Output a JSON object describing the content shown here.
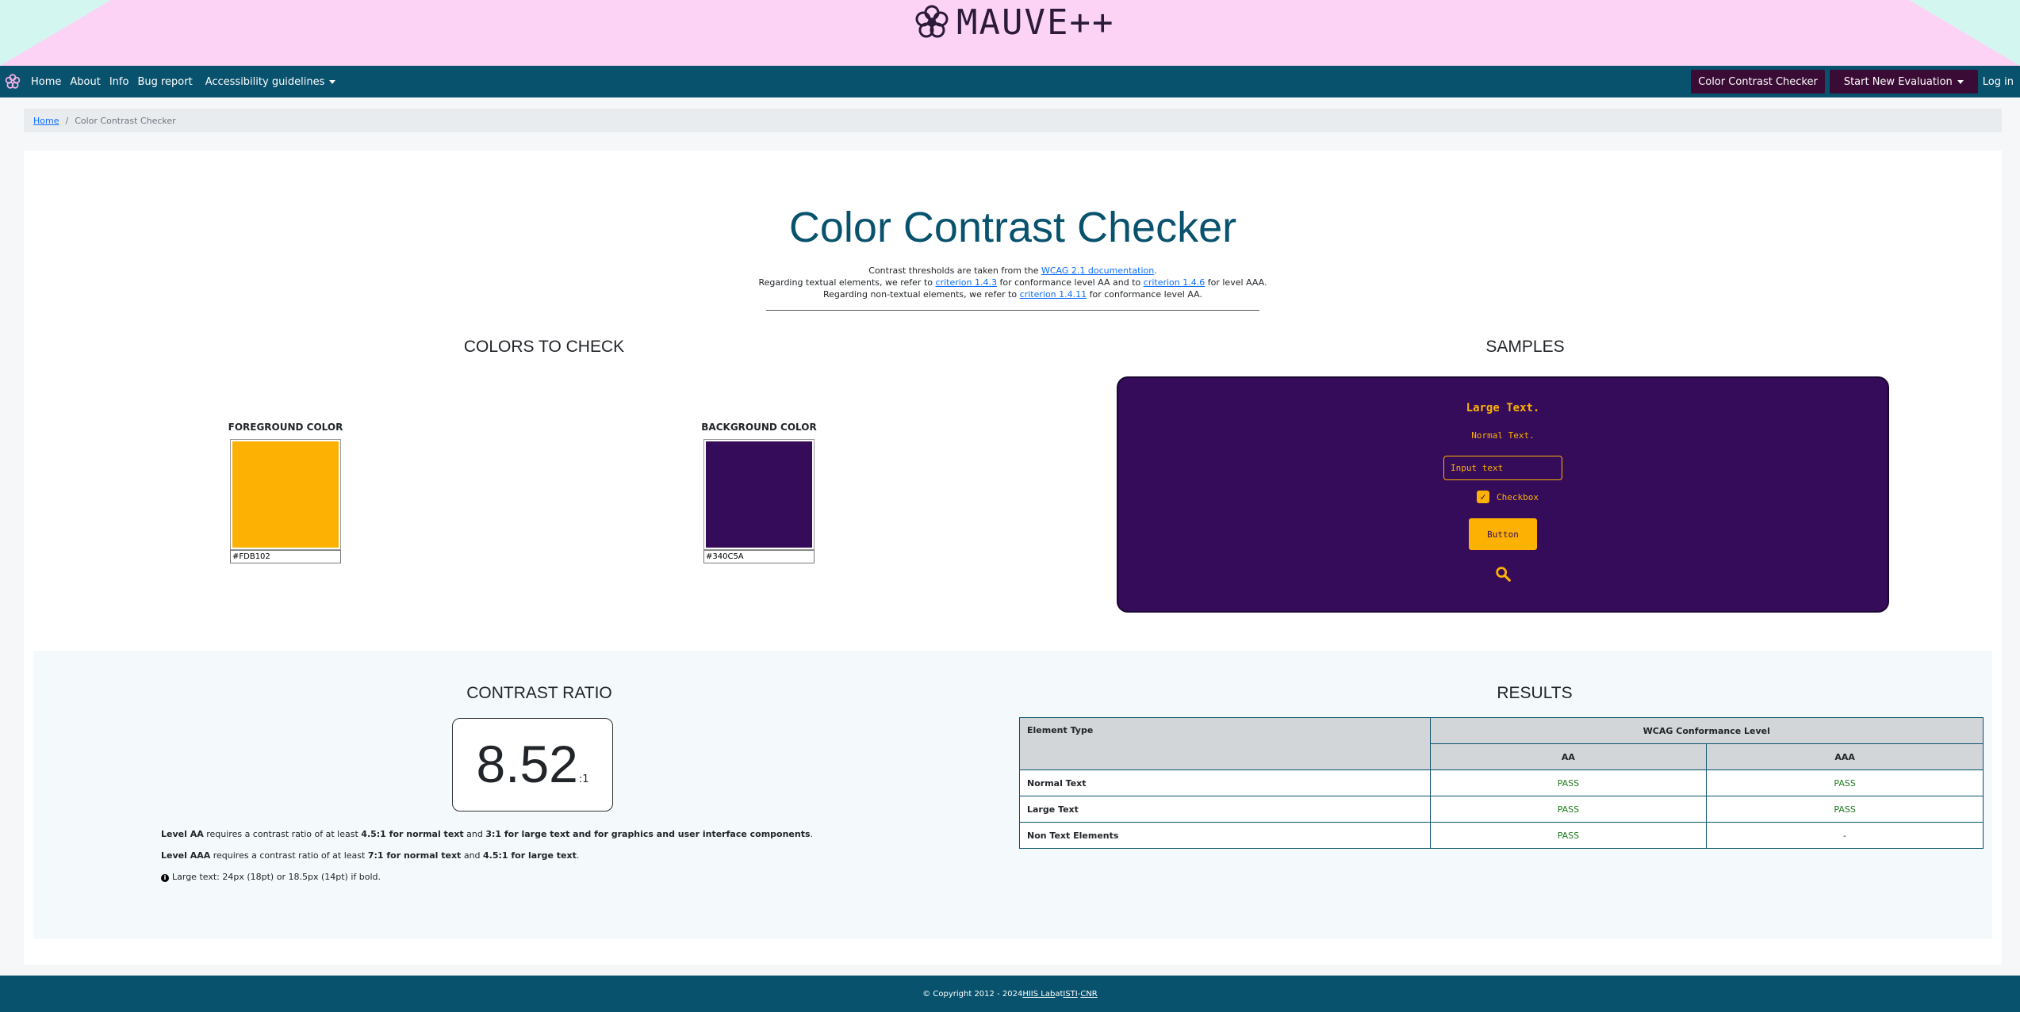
{
  "brand": {
    "name": "MAUVE++"
  },
  "nav": {
    "links": [
      "Home",
      "About",
      "Info",
      "Bug report",
      "Accessibility guidelines"
    ],
    "color_contrast_button": "Color Contrast Checker",
    "start_eval_button": "Start New Evaluation",
    "login": "Log in"
  },
  "breadcrumb": {
    "home": "Home",
    "separator": "/",
    "current": "Color Contrast Checker"
  },
  "page": {
    "title": "Color Contrast Checker",
    "intro": {
      "line1_pre": "Contrast thresholds are taken from the ",
      "line1_link": "WCAG 2.1 documentation",
      "line1_post": ".",
      "line2_pre": "Regarding textual elements, we refer to ",
      "line2_link1": "criterion 1.4.3",
      "line2_mid": " for conformance level AA and to ",
      "line2_link2": "criterion 1.4.6",
      "line2_post": " for level AAA.",
      "line3_pre": "Regarding non-textual elements, we refer to ",
      "line3_link": "criterion 1.4.11",
      "line3_post": " for conformance level AA."
    }
  },
  "colors_section": {
    "heading": "COLORS TO CHECK",
    "foreground": {
      "label": "FOREGROUND COLOR",
      "value": "#FDB102"
    },
    "background": {
      "label": "BACKGROUND COLOR",
      "value": "#340C5A"
    }
  },
  "samples": {
    "heading": "SAMPLES",
    "large_text": "Large Text.",
    "normal_text": "Normal Text.",
    "input_placeholder": "Input text",
    "checkbox_label": "Checkbox",
    "button_label": "Button",
    "icon": "search-icon"
  },
  "contrast": {
    "heading": "CONTRAST RATIO",
    "value": "8.52",
    "unit": ":1",
    "aa_prefix": "Level AA",
    "aa_text1": " requires a contrast ratio of at least ",
    "aa_bold1": "4.5:1 for normal text",
    "aa_text2": " and ",
    "aa_bold2": "3:1 for large text and for graphics and user interface components",
    "aa_end": ".",
    "aaa_prefix": "Level AAA",
    "aaa_text1": " requires a contrast ratio of at least ",
    "aaa_bold1": "7:1 for normal text",
    "aaa_text2": " and ",
    "aaa_bold2": "4.5:1 for large text",
    "aaa_end": ".",
    "note": "Large text: 24px (18pt) or 18.5px (14pt) if bold."
  },
  "results": {
    "heading": "RESULTS",
    "col_type": "Element Type",
    "col_level": "WCAG Conformance Level",
    "col_aa": "AA",
    "col_aaa": "AAA",
    "rows": [
      {
        "type": "Normal Text",
        "aa": "PASS",
        "aaa": "PASS"
      },
      {
        "type": "Large Text",
        "aa": "PASS",
        "aaa": "PASS"
      },
      {
        "type": "Non Text Elements",
        "aa": "PASS",
        "aaa": "-"
      }
    ]
  },
  "footer": {
    "copyright": "© Copyright 2012 - 2024 ",
    "hiis": "HIIS Lab",
    "at": " at ",
    "isti": "ISTI",
    "dash": " - ",
    "cnr": "CNR"
  },
  "colors": {
    "navbar": "#08526e",
    "banner": "#fcd3f5",
    "accent_dark": "#3a0b35",
    "foreground": "#FDB102",
    "background": "#340C5A",
    "pass": "#1e7b1e"
  }
}
